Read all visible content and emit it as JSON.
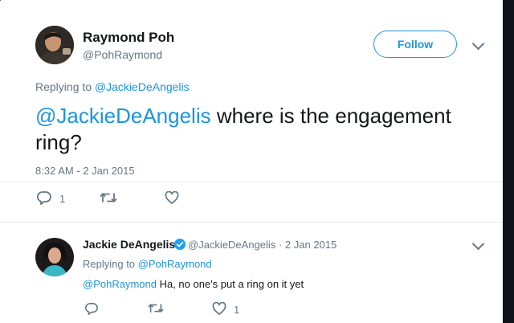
{
  "main_tweet": {
    "author_name": "Raymond Poh",
    "author_handle": "@PohRaymond",
    "follow_label": "Follow",
    "replying_prefix": "Replying to",
    "replying_handle": "@JackieDeAngelis",
    "mention": "@JackieDeAngelis",
    "text_line1": " where is the engagement",
    "text_line2": "ring?",
    "timestamp": "8:32 AM - 2 Jan 2015",
    "reply_count": "1",
    "retweet_count": "",
    "like_count": ""
  },
  "reply_tweet": {
    "author_name": "Jackie DeAngelis",
    "author_handle": "@JackieDeAngelis",
    "dot": "·",
    "date": "2 Jan 2015",
    "replying_prefix": "Replying to",
    "replying_handle": "@PohRaymond",
    "mention": "@PohRaymond",
    "text": " Ha, no one's put a ring on it yet",
    "reply_count": "",
    "retweet_count": "",
    "like_count": "1"
  },
  "colors": {
    "accent": "#1b95e0",
    "muted": "#657786",
    "text": "#14171a",
    "verified": "#1da1f2"
  }
}
